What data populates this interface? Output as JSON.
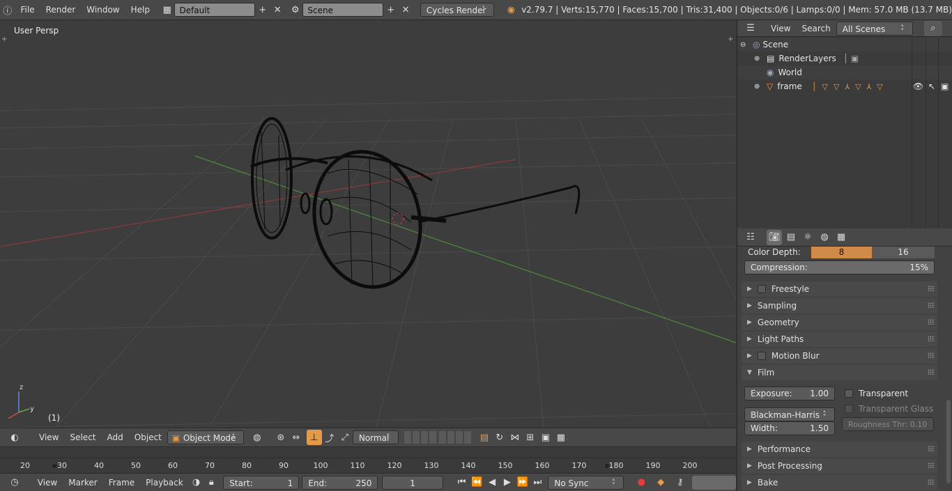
{
  "menu": {
    "file": "File",
    "render": "Render",
    "window": "Window",
    "help": "Help"
  },
  "layout_name": "Default",
  "scene_name": "Scene",
  "engine": "Cycles Render",
  "stats": "v2.79.7 | Verts:15,770 | Faces:15,700 | Tris:31,400 | Objects:0/6 | Lamps:0/0 | Mem: 57.0 MB (13.7 MB)",
  "viewport": {
    "label": "User Persp",
    "frame": "(1)",
    "axis_z": "z",
    "axis_y": "y"
  },
  "vp_header": {
    "view": "View",
    "select": "Select",
    "add": "Add",
    "object": "Object",
    "mode": "Object Mode",
    "orientation": "Normal"
  },
  "timeline": {
    "ticks": [
      "20",
      "30",
      "40",
      "50",
      "60",
      "70",
      "80",
      "90",
      "100",
      "110",
      "120",
      "130",
      "140",
      "150",
      "160",
      "170",
      "180",
      "190",
      "200"
    ],
    "view": "View",
    "marker": "Marker",
    "frame": "Frame",
    "playback": "Playback",
    "start_label": "Start:",
    "start": "1",
    "end_label": "End:",
    "end": "250",
    "current": "1",
    "sync": "No Sync"
  },
  "outliner": {
    "view": "View",
    "search": "Search",
    "filter": "All Scenes",
    "rows": [
      {
        "label": "Scene"
      },
      {
        "label": "RenderLayers"
      },
      {
        "label": "World"
      },
      {
        "label": "frame"
      }
    ]
  },
  "properties": {
    "color_depth_label": "Color Depth:",
    "depth_8": "8",
    "depth_16": "16",
    "compression_label": "Compression:",
    "compression": "15%",
    "panels": {
      "freestyle": "Freestyle",
      "sampling": "Sampling",
      "geometry": "Geometry",
      "light_paths": "Light Paths",
      "motion_blur": "Motion Blur",
      "film": "Film",
      "performance": "Performance",
      "post_processing": "Post Processing",
      "bake": "Bake"
    },
    "film": {
      "exposure_label": "Exposure:",
      "exposure": "1.00",
      "transparent": "Transparent",
      "transparent_glass": "Transparent Glass",
      "filter": "Blackman-Harris",
      "width_label": "Width:",
      "width": "1.50",
      "roughness": "Roughness Thr: 0.10"
    }
  },
  "colors": {
    "accent": "#e49b49",
    "header": "#484848",
    "viewport": "#3d3d3d",
    "selected_depth": "#d08a4a"
  }
}
